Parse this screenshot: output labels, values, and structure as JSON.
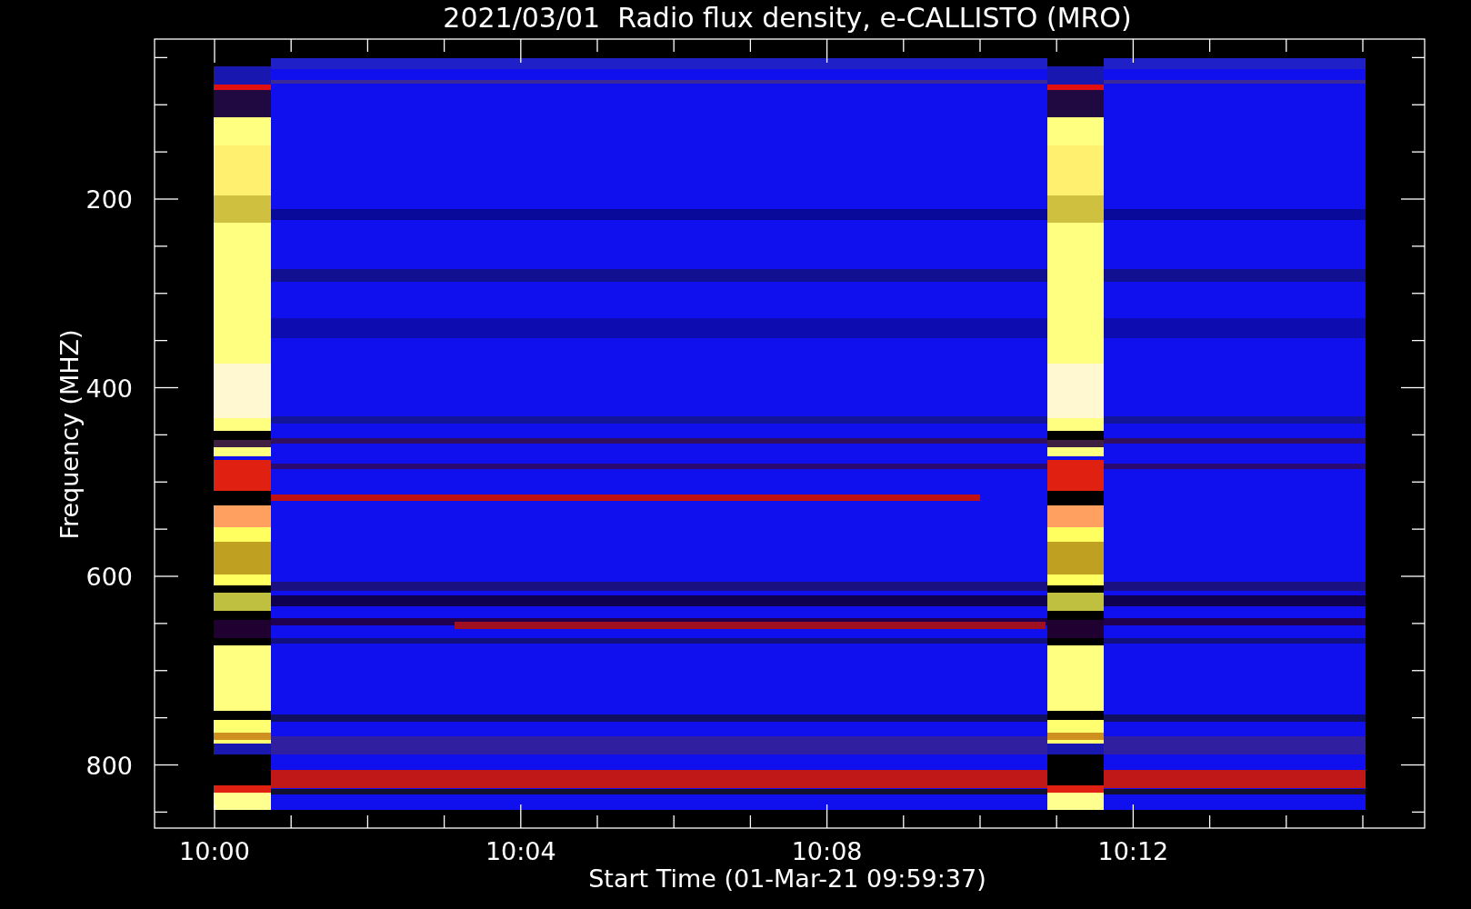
{
  "plot": {
    "title": "2021/03/01  Radio flux density, e-CALLISTO (MRO)",
    "xlabel": "Start Time (01-Mar-21 09:59:37)",
    "ylabel": "Frequency (MHZ)",
    "xticks": [
      "10:00",
      "10:04",
      "10:08",
      "10:12"
    ],
    "yticks": [
      "200",
      "400",
      "600",
      "800"
    ]
  }
}
